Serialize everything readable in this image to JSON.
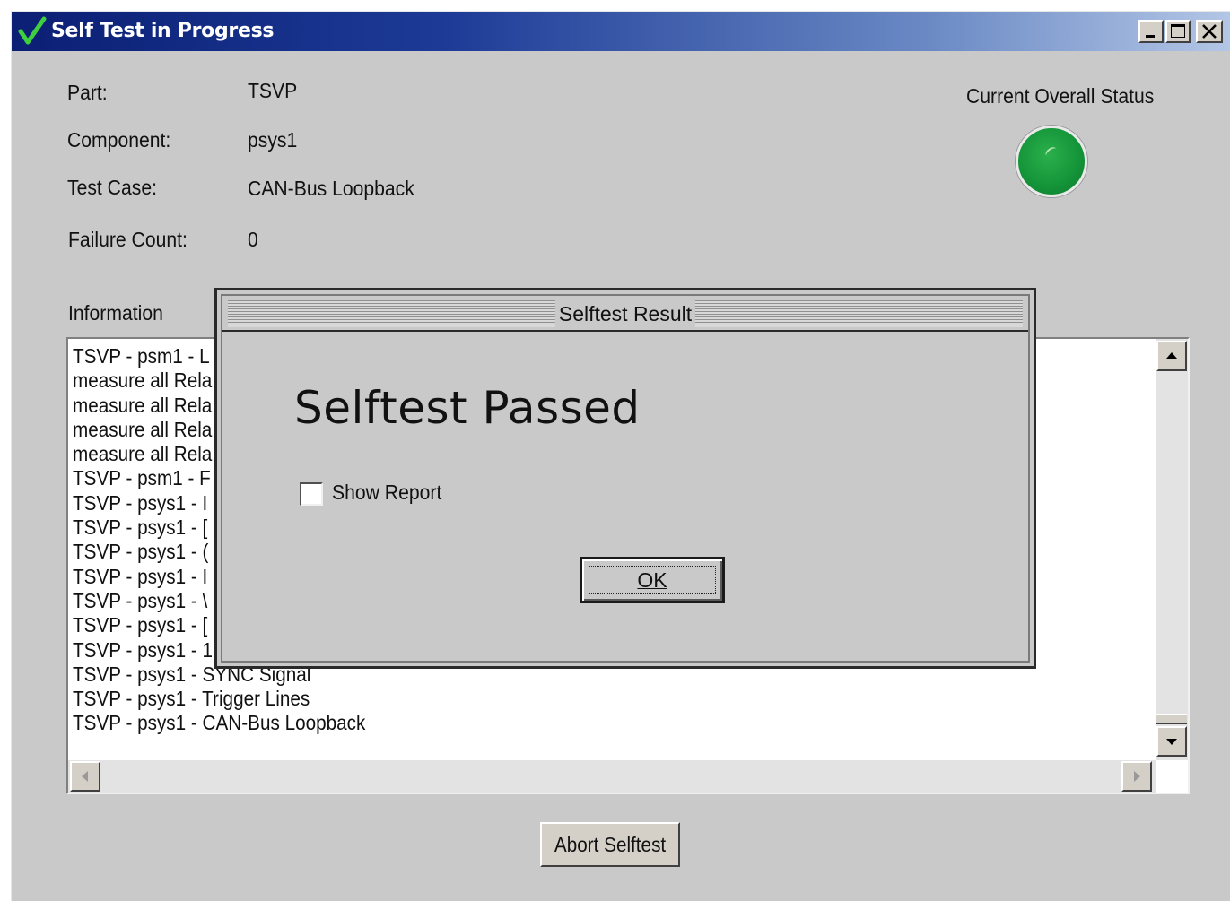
{
  "window": {
    "title": "Self Test in Progress"
  },
  "fields": {
    "part_label": "Part:",
    "part_value": "TSVP",
    "component_label": "Component:",
    "component_value": "psys1",
    "testcase_label": "Test Case:",
    "testcase_value": "CAN-Bus Loopback",
    "failure_label": "Failure Count:",
    "failure_value": "0"
  },
  "status": {
    "label": "Current Overall Status",
    "color": "#15963a",
    "icon": "status-light-green"
  },
  "information": {
    "label": "Information",
    "lines": [
      "TSVP - psm1 - L",
      "measure all Rela",
      "measure all Rela",
      "measure all Rela",
      "measure all Rela",
      "TSVP - psm1 - F",
      "TSVP - psys1 - I",
      "TSVP - psys1 - [",
      "TSVP - psys1 - (",
      "TSVP - psys1 - I",
      "TSVP - psys1 - \\",
      "TSVP - psys1 - [",
      "TSVP - psys1 - 1",
      "TSVP - psys1 - SYNC Signal",
      "TSVP - psys1 - Trigger Lines",
      "TSVP - psys1 - CAN-Bus Loopback"
    ]
  },
  "buttons": {
    "abort": "Abort Selftest"
  },
  "dialog": {
    "title": "Selftest Result",
    "heading": "Selftest Passed",
    "checkbox_label": "Show Report",
    "checkbox_checked": false,
    "ok_label": "OK"
  }
}
